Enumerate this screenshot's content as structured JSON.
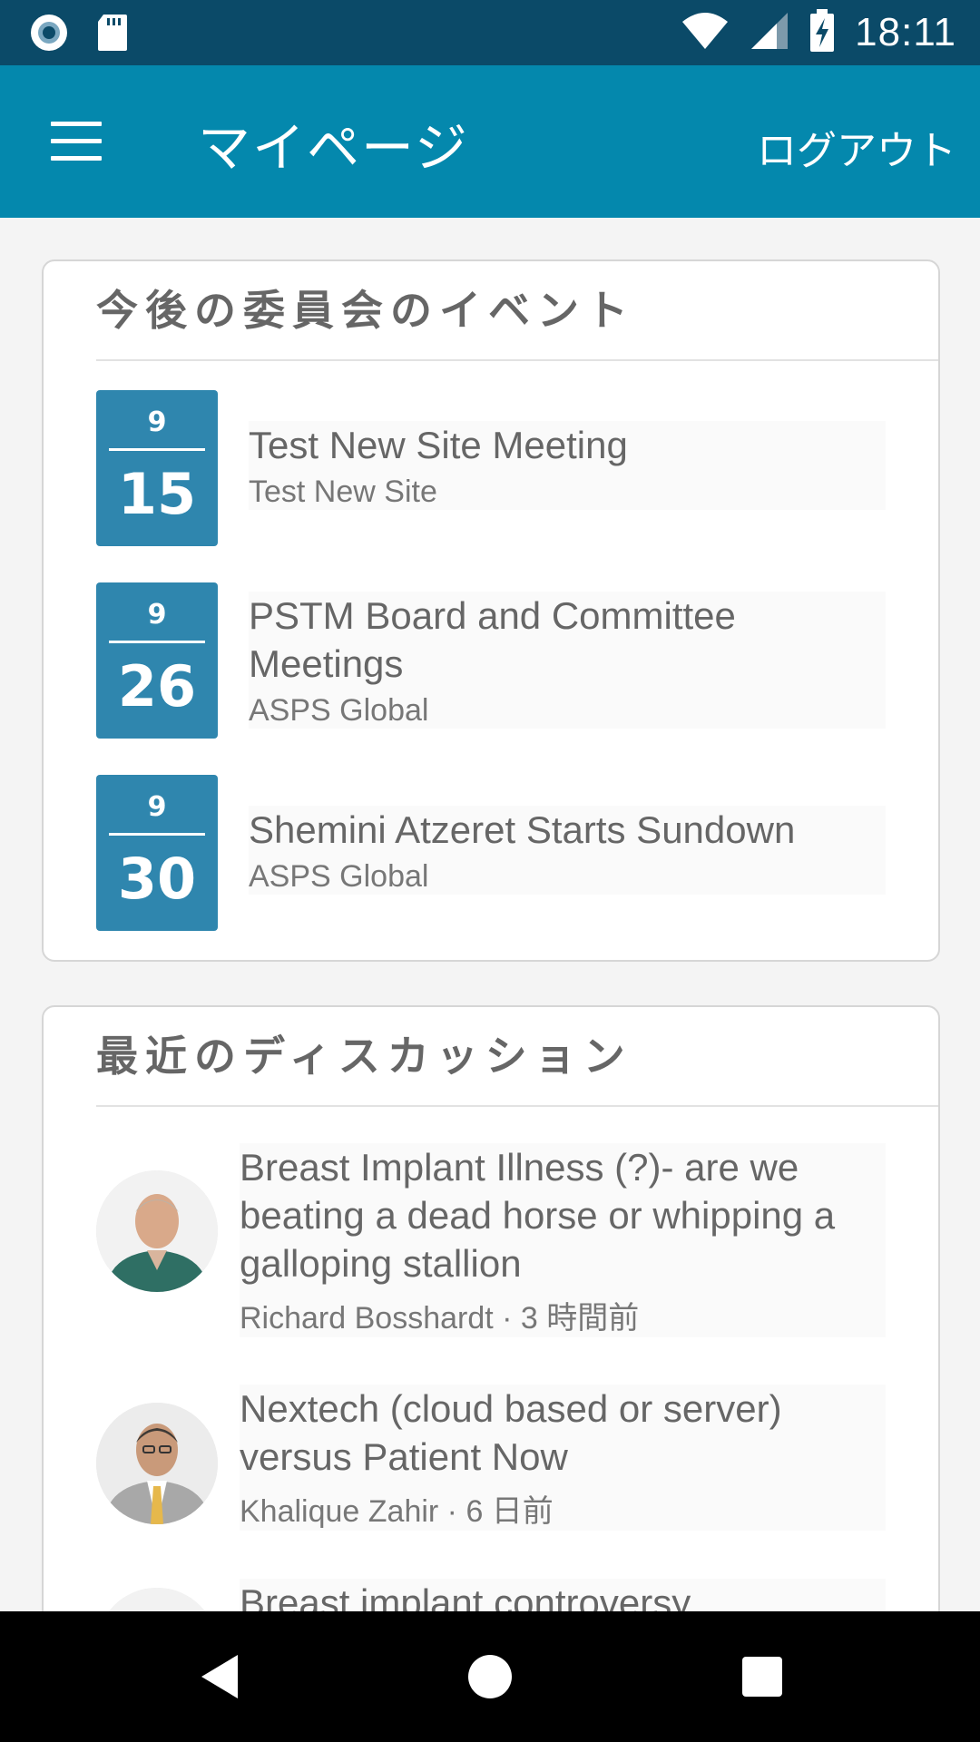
{
  "status_bar": {
    "time": "18:11",
    "icons": [
      "record-icon",
      "sd-card-icon",
      "wifi-icon",
      "signal-icon",
      "battery-charging-icon"
    ]
  },
  "app_bar": {
    "menu_icon": "hamburger-menu-icon",
    "title": "マイページ",
    "logout_label": "ログアウト",
    "color": "#0488ad"
  },
  "events_card": {
    "header": "今後の委員会のイベント",
    "items": [
      {
        "month": "9",
        "day": "15",
        "title": "Test New Site Meeting",
        "subtitle": "Test New Site"
      },
      {
        "month": "9",
        "day": "26",
        "title": "PSTM Board and Committee Meetings",
        "subtitle": "ASPS Global"
      },
      {
        "month": "9",
        "day": "30",
        "title": "Shemini Atzeret Starts Sundown",
        "subtitle": "ASPS Global"
      }
    ],
    "date_box_color": "#2f86ae"
  },
  "discussions_card": {
    "header": "最近のディスカッション",
    "items": [
      {
        "title": "Breast Implant Illness (?)- are we beating a dead horse or whipping a galloping stallion",
        "author": "Richard Bosshardt",
        "time": "3 時間前",
        "meta": "Richard Bosshardt · 3 時間前"
      },
      {
        "title": "Nextech (cloud based or server) versus Patient Now",
        "author": "Khalique Zahir",
        "time": "6 日前",
        "meta": "Khalique Zahir · 6 日前"
      },
      {
        "title": "Breast implant controversy",
        "author": "",
        "time": "",
        "meta": ""
      }
    ]
  },
  "nav_bar": {
    "icons": [
      "back-icon",
      "home-icon",
      "recents-icon"
    ]
  }
}
